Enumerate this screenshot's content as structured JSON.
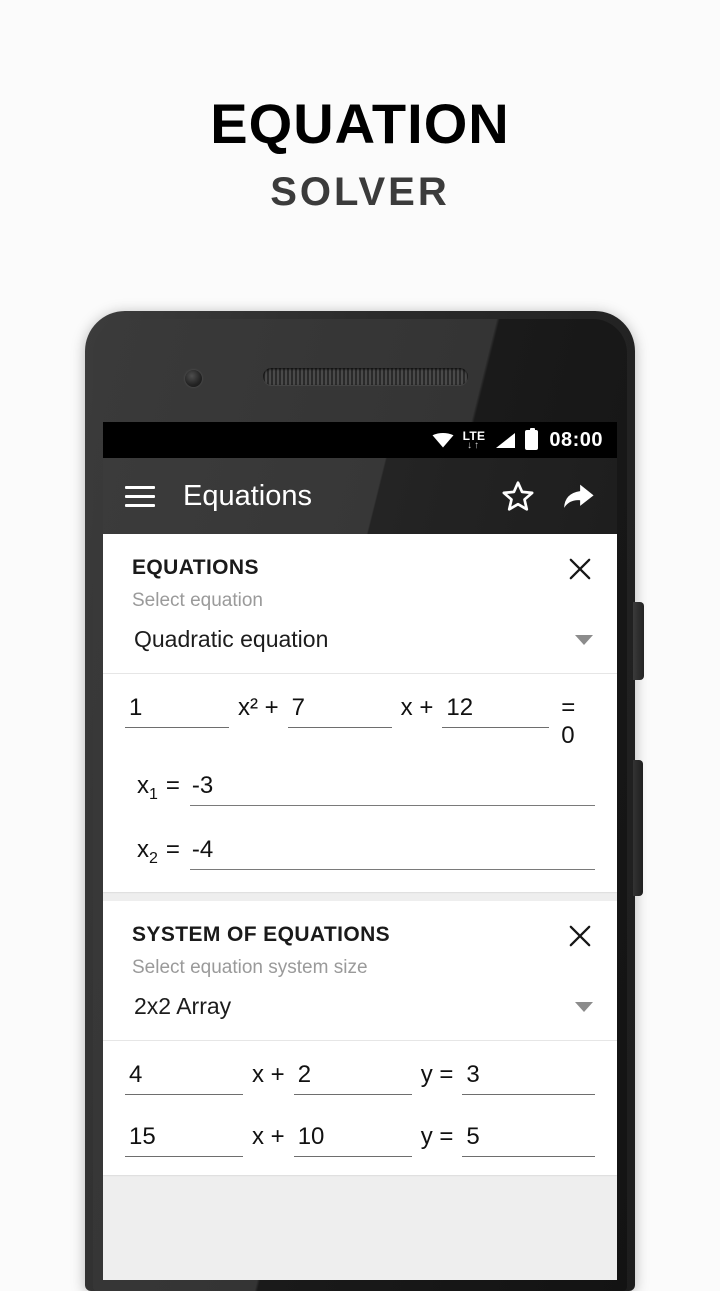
{
  "promo": {
    "title": "EQUATION",
    "subtitle": "SOLVER"
  },
  "status_bar": {
    "wifi_icon": "wifi-icon",
    "network_label": "LTE",
    "network_arrows": "↓↑",
    "signal_icon": "signal-bars-icon",
    "battery_icon": "battery-full-icon",
    "time": "08:00"
  },
  "app_bar": {
    "menu_icon": "hamburger-menu-icon",
    "title": "Equations",
    "favorite_icon": "star-outline-icon",
    "share_icon": "share-arrow-icon"
  },
  "cards": {
    "equations": {
      "title": "EQUATIONS",
      "close_icon": "close-x-icon",
      "select_label": "Select equation",
      "selected_type": "Quadratic equation",
      "caret_icon": "chevron-down-icon",
      "quadratic": {
        "coef_a": "1",
        "term_a": "x² +",
        "coef_b": "7",
        "term_b": "x +",
        "coef_c": "12",
        "equals": "= 0"
      },
      "solutions": [
        {
          "label": "x",
          "index": "1",
          "equals": "=",
          "value": "-3"
        },
        {
          "label": "x",
          "index": "2",
          "equals": "=",
          "value": "-4"
        }
      ]
    },
    "system": {
      "title": "SYSTEM OF EQUATIONS",
      "close_icon": "close-x-icon",
      "select_label": "Select equation system size",
      "selected_size": "2x2 Array",
      "caret_icon": "chevron-down-icon",
      "rows": [
        {
          "coef_x": "4",
          "term_x": "x +",
          "coef_y": "2",
          "term_y": "y =",
          "rhs": "3"
        },
        {
          "coef_x": "15",
          "term_x": "x +",
          "coef_y": "10",
          "term_y": "y =",
          "rhs": "5"
        }
      ]
    }
  },
  "colors": {
    "background": "#fbfbfb",
    "appbar": "#2e2e2e",
    "statusbar": "#000000",
    "card": "#ffffff",
    "screen_bg": "#eeeeee",
    "muted_text": "#9a9a9a"
  }
}
